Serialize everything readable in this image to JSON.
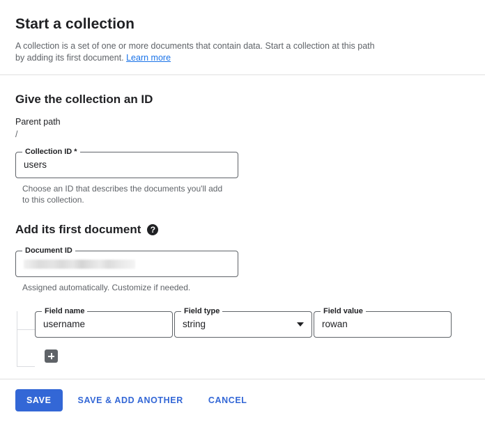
{
  "header": {
    "title": "Start a collection",
    "description_part1": "A collection is a set of one or more documents that contain data. Start a collection at this path by adding its first document. ",
    "learn_more_label": "Learn more"
  },
  "collection_section": {
    "title": "Give the collection an ID",
    "parent_path_label": "Parent path",
    "parent_path_value": "/",
    "collection_id": {
      "label": "Collection ID *",
      "value": "users"
    },
    "hint": "Choose an ID that describes the documents you'll add to this collection."
  },
  "document_section": {
    "title": "Add its first document",
    "help_icon": "help-icon",
    "help_glyph": "?",
    "document_id": {
      "label": "Document ID",
      "value": "",
      "redacted": true
    },
    "hint": "Assigned automatically. Customize if needed.",
    "fields": [
      {
        "name_label": "Field name",
        "name_value": "username",
        "type_label": "Field type",
        "type_value": "string",
        "type_icon": "chevron-down-icon",
        "value_label": "Field value",
        "value_value": "rowan"
      }
    ],
    "add_field_icon": "plus-icon"
  },
  "footer": {
    "save_label": "SAVE",
    "save_add_another_label": "SAVE & ADD ANOTHER",
    "cancel_label": "CANCEL"
  },
  "colors": {
    "accent": "#3367d6",
    "link": "#1a73e8",
    "text_primary": "#202124",
    "text_secondary": "#5f6368",
    "divider": "#e0e0e0",
    "add_button": "#5f6368"
  }
}
